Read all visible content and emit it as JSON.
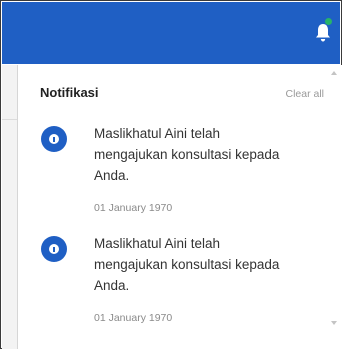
{
  "header": {
    "bell_icon": "bell-icon",
    "accent_color": "#1f5fc4",
    "indicator_color": "#27b36a"
  },
  "notifications_panel": {
    "title": "Notifikasi",
    "clear_all_label": "Clear all",
    "items": [
      {
        "icon": "info-icon",
        "message": "Maslikhatul Aini telah mengajukan konsultasi kepada Anda.",
        "date": "01 January 1970"
      },
      {
        "icon": "info-icon",
        "message": "Maslikhatul Aini telah mengajukan konsultasi kepada Anda.",
        "date": "01 January 1970"
      }
    ]
  }
}
